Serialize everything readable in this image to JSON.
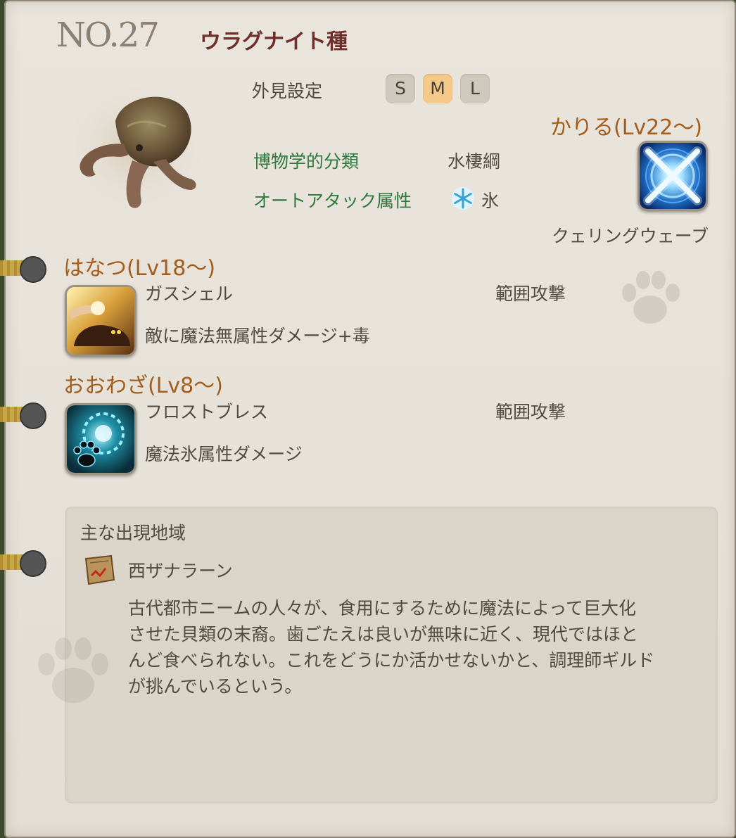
{
  "header": {
    "number": "NO.27",
    "name": "ウラグナイト種"
  },
  "appearance": {
    "label": "外見設定",
    "sizes": [
      "S",
      "M",
      "L"
    ],
    "selected": "M"
  },
  "classification": {
    "label": "博物学的分類",
    "value": "水棲綱"
  },
  "auto_attack": {
    "label": "オートアタック属性",
    "icon": "ice-snowflake-icon",
    "value": "氷"
  },
  "kariru": {
    "title": "かりる(Lv22～)",
    "skill_name": "クェリングウェーブ",
    "icon": "cross-burst-icon"
  },
  "hanatsu": {
    "title": "はなつ(Lv18～)",
    "skill_name": "ガスシェル",
    "type": "範囲攻撃",
    "description": "敵に魔法無属性ダメージ+毒",
    "icon": "gas-shell-icon"
  },
  "oowaza": {
    "title": "おおわざ(Lv8～)",
    "skill_name": "フロストブレス",
    "type": "範囲攻撃",
    "description": "魔法氷属性ダメージ",
    "icon": "frost-paw-icon"
  },
  "habitat": {
    "heading": "主な出現地域",
    "location": "西ザナラーン",
    "lines": [
      "古代都市ニームの人々が、食用にするために魔法によって巨大化",
      "させた貝類の末裔。歯ごたえは良いが無味に近く、現代ではほと",
      "んど食べられない。これをどうにか活かせないかと、調理師ギルド",
      "が挑んでいるという。"
    ]
  },
  "colors": {
    "title": "#6e2f2a",
    "green_label": "#2e7a3d",
    "orange_heading": "#a45c1a",
    "selected_size": "#f4c98a",
    "page": "#e7e2da"
  }
}
